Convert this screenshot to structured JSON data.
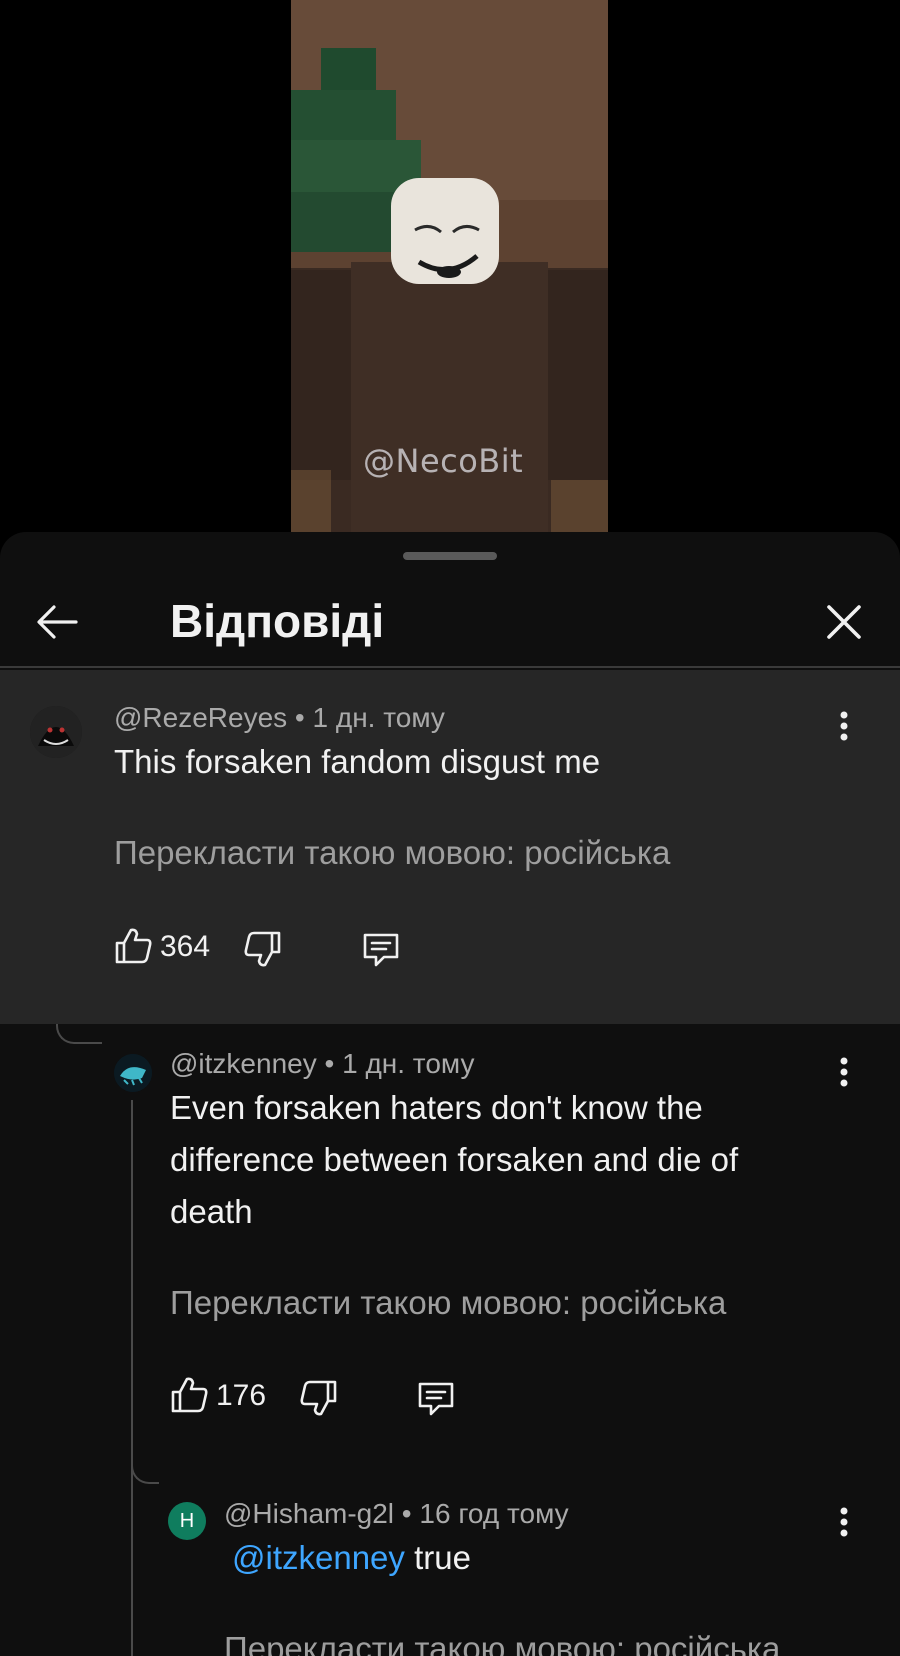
{
  "video": {
    "watermark": "@NecoBit"
  },
  "sheet": {
    "title": "Відповіді"
  },
  "comments": [
    {
      "author": "@RezeReyes",
      "time": "1 дн. тому",
      "text": "This forsaken fandom disgust me",
      "translate": "Перекласти такою мовою: російська",
      "likes": "364"
    },
    {
      "author": "@itzkenney",
      "time": "1 дн. тому",
      "text_line1": "Even forsaken haters don't know the",
      "text_line2": "difference between forsaken and die of",
      "text_line3": "death",
      "translate": "Перекласти такою мовою: російська",
      "likes": "176"
    },
    {
      "avatar_letter": "H",
      "author": "@Hisham-g2l",
      "time": "16 год тому",
      "mention": "@itzkenney",
      "text": "true",
      "translate": "Перекласти такою мовою: російська"
    }
  ],
  "separator": " • ",
  "colors": {
    "sheet_bg": "#0f0f0f",
    "highlight_bg": "#262626",
    "mention": "#3ea6ff",
    "secondary_text": "#aaaaaa",
    "avatar_h": "#0f7d5e"
  },
  "icons": [
    "back-arrow-icon",
    "close-icon",
    "more-vert-icon",
    "thumbs-up-icon",
    "thumbs-down-icon",
    "reply-icon"
  ]
}
